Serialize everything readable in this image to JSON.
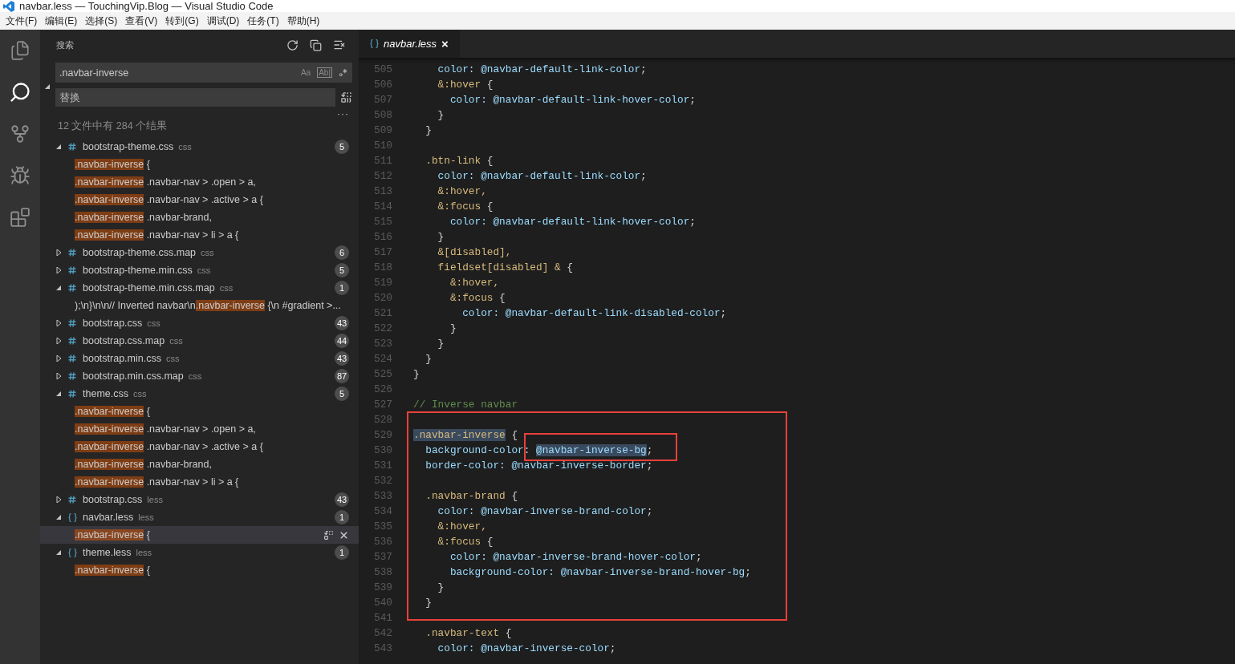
{
  "window": {
    "title": "navbar.less — TouchingVip.Blog — Visual Studio Code"
  },
  "menu": [
    "文件(F)",
    "编辑(E)",
    "选择(S)",
    "查看(V)",
    "转到(G)",
    "调试(D)",
    "任务(T)",
    "帮助(H)"
  ],
  "activity_bar": [
    {
      "kind": "files",
      "selected": false
    },
    {
      "kind": "search",
      "selected": true
    },
    {
      "kind": "git",
      "selected": false
    },
    {
      "kind": "debug",
      "selected": false
    },
    {
      "kind": "extensions",
      "selected": false
    }
  ],
  "sidebar": {
    "title": "搜索",
    "search": {
      "value": ".navbar-inverse",
      "match_case": "Aa",
      "whole_word": "Ab|"
    },
    "replace": {
      "placeholder": "替换",
      "expanded": true
    },
    "more": "···",
    "summary": "12 文件中有 284 个结果",
    "results": [
      {
        "kind": "css",
        "name": "bootstrap-theme.css",
        "ext": "css",
        "count": "5",
        "expanded": true,
        "matches": [
          {
            "match": ".navbar-inverse",
            "suffix": " {",
            "selected": false
          },
          {
            "match": ".navbar-inverse",
            "suffix": " .navbar-nav > .open > a,",
            "selected": false
          },
          {
            "match": ".navbar-inverse",
            "suffix": " .navbar-nav > .active > a {",
            "selected": false
          },
          {
            "match": ".navbar-inverse",
            "suffix": " .navbar-brand,",
            "selected": false
          },
          {
            "match": ".navbar-inverse",
            "suffix": " .navbar-nav > li > a {",
            "selected": false
          }
        ]
      },
      {
        "kind": "css",
        "name": "bootstrap-theme.css.map",
        "ext": "css",
        "count": "6",
        "expanded": false
      },
      {
        "kind": "css",
        "name": "bootstrap-theme.min.css",
        "ext": "css",
        "count": "5",
        "expanded": false
      },
      {
        "kind": "css",
        "name": "bootstrap-theme.min.css.map",
        "ext": "css",
        "count": "1",
        "expanded": true,
        "matches": [
          {
            "prefix": ");\\n}\\n\\n// Inverted navbar\\n",
            "match": ".navbar-inverse",
            "suffix": " {\\n #gradient >...",
            "selected": false
          }
        ]
      },
      {
        "kind": "css",
        "name": "bootstrap.css",
        "ext": "css",
        "count": "43",
        "expanded": false
      },
      {
        "kind": "css",
        "name": "bootstrap.css.map",
        "ext": "css",
        "count": "44",
        "expanded": false
      },
      {
        "kind": "css",
        "name": "bootstrap.min.css",
        "ext": "css",
        "count": "43",
        "expanded": false
      },
      {
        "kind": "css",
        "name": "bootstrap.min.css.map",
        "ext": "css",
        "count": "87",
        "expanded": false
      },
      {
        "kind": "css",
        "name": "theme.css",
        "ext": "css",
        "count": "5",
        "expanded": true,
        "matches": [
          {
            "match": ".navbar-inverse",
            "suffix": " {",
            "selected": false
          },
          {
            "match": ".navbar-inverse",
            "suffix": " .navbar-nav > .open > a,",
            "selected": false
          },
          {
            "match": ".navbar-inverse",
            "suffix": " .navbar-nav > .active > a {",
            "selected": false
          },
          {
            "match": ".navbar-inverse",
            "suffix": " .navbar-brand,",
            "selected": false
          },
          {
            "match": ".navbar-inverse",
            "suffix": " .navbar-nav > li > a {",
            "selected": false
          }
        ]
      },
      {
        "kind": "css",
        "name": "bootstrap.css",
        "ext": "less",
        "count": "43",
        "expanded": false
      },
      {
        "kind": "less",
        "name": "navbar.less",
        "ext": "less",
        "count": "1",
        "expanded": true,
        "matches": [
          {
            "match": ".navbar-inverse",
            "suffix": " {",
            "selected": true
          }
        ]
      },
      {
        "kind": "less",
        "name": "theme.less",
        "ext": "less",
        "count": "1",
        "expanded": true,
        "matches": [
          {
            "match": ".navbar-inverse",
            "suffix": " {",
            "selected": false
          }
        ]
      }
    ]
  },
  "editor": {
    "tab": {
      "title": "navbar.less",
      "close": "×",
      "selected": true
    },
    "lines": [
      {
        "number": "505",
        "tokens": [
          {
            "kind": "property",
            "text": "    color: "
          },
          {
            "kind": "variable",
            "text": "@navbar-default-link-color"
          },
          {
            "kind": "punct",
            "text": ";"
          }
        ]
      },
      {
        "number": "506",
        "tokens": [
          {
            "kind": "selector",
            "text": "    &:hover"
          },
          {
            "kind": "punct",
            "text": " {"
          }
        ]
      },
      {
        "number": "507",
        "tokens": [
          {
            "kind": "property",
            "text": "      color: "
          },
          {
            "kind": "variable",
            "text": "@navbar-default-link-hover-color"
          },
          {
            "kind": "punct",
            "text": ";"
          }
        ]
      },
      {
        "number": "508",
        "tokens": [
          {
            "kind": "punct",
            "text": "    }"
          }
        ]
      },
      {
        "number": "509",
        "tokens": [
          {
            "kind": "punct",
            "text": "  }"
          }
        ]
      },
      {
        "number": "510"
      },
      {
        "number": "511",
        "tokens": [
          {
            "kind": "selector",
            "text": "  .btn-link"
          },
          {
            "kind": "punct",
            "text": " {"
          }
        ]
      },
      {
        "number": "512",
        "tokens": [
          {
            "kind": "property",
            "text": "    color: "
          },
          {
            "kind": "variable",
            "text": "@navbar-default-link-color"
          },
          {
            "kind": "punct",
            "text": ";"
          }
        ]
      },
      {
        "number": "513",
        "tokens": [
          {
            "kind": "selector",
            "text": "    &:hover,"
          }
        ]
      },
      {
        "number": "514",
        "tokens": [
          {
            "kind": "selector",
            "text": "    &:focus"
          },
          {
            "kind": "punct",
            "text": " {"
          }
        ]
      },
      {
        "number": "515",
        "tokens": [
          {
            "kind": "property",
            "text": "      color: "
          },
          {
            "kind": "variable",
            "text": "@navbar-default-link-hover-color"
          },
          {
            "kind": "punct",
            "text": ";"
          }
        ]
      },
      {
        "number": "516",
        "tokens": [
          {
            "kind": "punct",
            "text": "    }"
          }
        ]
      },
      {
        "number": "517",
        "tokens": [
          {
            "kind": "selector",
            "text": "    &[disabled],"
          }
        ]
      },
      {
        "number": "518",
        "tokens": [
          {
            "kind": "selector",
            "text": "    fieldset[disabled] &"
          },
          {
            "kind": "punct",
            "text": " {"
          }
        ]
      },
      {
        "number": "519",
        "tokens": [
          {
            "kind": "selector",
            "text": "      &:hover,"
          }
        ]
      },
      {
        "number": "520",
        "tokens": [
          {
            "kind": "selector",
            "text": "      &:focus"
          },
          {
            "kind": "punct",
            "text": " {"
          }
        ]
      },
      {
        "number": "521",
        "tokens": [
          {
            "kind": "property",
            "text": "        color: "
          },
          {
            "kind": "variable",
            "text": "@navbar-default-link-disabled-color"
          },
          {
            "kind": "punct",
            "text": ";"
          }
        ]
      },
      {
        "number": "522",
        "tokens": [
          {
            "kind": "punct",
            "text": "      }"
          }
        ]
      },
      {
        "number": "523",
        "tokens": [
          {
            "kind": "punct",
            "text": "    }"
          }
        ]
      },
      {
        "number": "524",
        "tokens": [
          {
            "kind": "punct",
            "text": "  }"
          }
        ]
      },
      {
        "number": "525",
        "tokens": [
          {
            "kind": "punct",
            "text": "}"
          }
        ]
      },
      {
        "number": "526"
      },
      {
        "number": "527",
        "tokens": [
          {
            "kind": "comment",
            "text": "// Inverse navbar"
          }
        ]
      },
      {
        "number": "528"
      },
      {
        "number": "529",
        "tokens": [
          {
            "kind": "selector",
            "text": ".navbar-inverse",
            "highlighted": true
          },
          {
            "kind": "punct",
            "text": " {"
          }
        ]
      },
      {
        "number": "530",
        "tokens": [
          {
            "kind": "property",
            "text": "  background-color: "
          },
          {
            "kind": "variable",
            "text": "@navbar-inverse-bg",
            "highlighted": true
          },
          {
            "kind": "punct",
            "text": ";"
          }
        ]
      },
      {
        "number": "531",
        "tokens": [
          {
            "kind": "property",
            "text": "  border-color: "
          },
          {
            "kind": "variable",
            "text": "@navbar-inverse-border"
          },
          {
            "kind": "punct",
            "text": ";"
          }
        ]
      },
      {
        "number": "532"
      },
      {
        "number": "533",
        "tokens": [
          {
            "kind": "selector",
            "text": "  .navbar-brand"
          },
          {
            "kind": "punct",
            "text": " {"
          }
        ]
      },
      {
        "number": "534",
        "tokens": [
          {
            "kind": "property",
            "text": "    color: "
          },
          {
            "kind": "variable",
            "text": "@navbar-inverse-brand-color"
          },
          {
            "kind": "punct",
            "text": ";"
          }
        ]
      },
      {
        "number": "535",
        "tokens": [
          {
            "kind": "selector",
            "text": "    &:hover,"
          }
        ]
      },
      {
        "number": "536",
        "tokens": [
          {
            "kind": "selector",
            "text": "    &:focus"
          },
          {
            "kind": "punct",
            "text": " {"
          }
        ]
      },
      {
        "number": "537",
        "tokens": [
          {
            "kind": "property",
            "text": "      color: "
          },
          {
            "kind": "variable",
            "text": "@navbar-inverse-brand-hover-color"
          },
          {
            "kind": "punct",
            "text": ";"
          }
        ]
      },
      {
        "number": "538",
        "tokens": [
          {
            "kind": "property",
            "text": "      background-color: "
          },
          {
            "kind": "variable",
            "text": "@navbar-inverse-brand-hover-bg"
          },
          {
            "kind": "punct",
            "text": ";"
          }
        ]
      },
      {
        "number": "539",
        "tokens": [
          {
            "kind": "punct",
            "text": "    }"
          }
        ]
      },
      {
        "number": "540",
        "tokens": [
          {
            "kind": "punct",
            "text": "  }"
          }
        ]
      },
      {
        "number": "541"
      },
      {
        "number": "542",
        "tokens": [
          {
            "kind": "selector",
            "text": "  .navbar-text"
          },
          {
            "kind": "punct",
            "text": " {"
          }
        ]
      },
      {
        "number": "543",
        "tokens": [
          {
            "kind": "property",
            "text": "    color: "
          },
          {
            "kind": "variable",
            "text": "@navbar-inverse-color"
          },
          {
            "kind": "punct",
            "text": ";"
          }
        ]
      }
    ]
  }
}
